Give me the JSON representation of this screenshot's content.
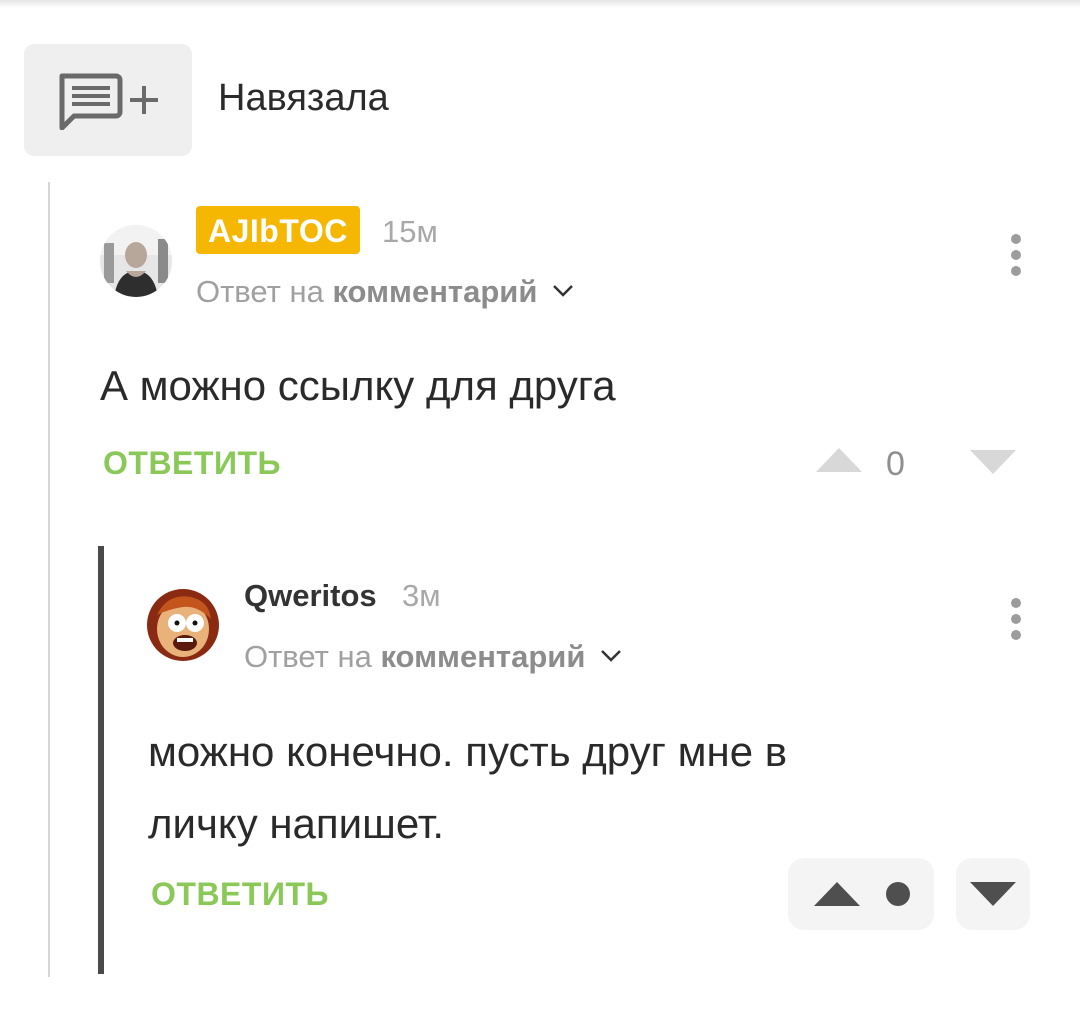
{
  "header": {
    "title": "Навязала",
    "icon": "add-comment-icon"
  },
  "comments": [
    {
      "author": "AJIbTOC",
      "author_badge_color": "#f5b701",
      "time": "15м",
      "reply_prefix": "Ответ на",
      "reply_target": "комментарий",
      "text": "А можно ссылку для друга",
      "reply_label": "ОТВЕТИТЬ",
      "rating": "0"
    },
    {
      "author": "Qweritos",
      "time": "3м",
      "reply_prefix": "Ответ на",
      "reply_target": "комментарий",
      "text_line1": "можно конечно. пусть друг мне в",
      "text_line2": "личку напишет.",
      "reply_label": "ОТВЕТИТЬ"
    }
  ],
  "colors": {
    "accent_green": "#8ac858",
    "thread_active": "#4a4a4a",
    "muted": "#a0a0a0"
  }
}
